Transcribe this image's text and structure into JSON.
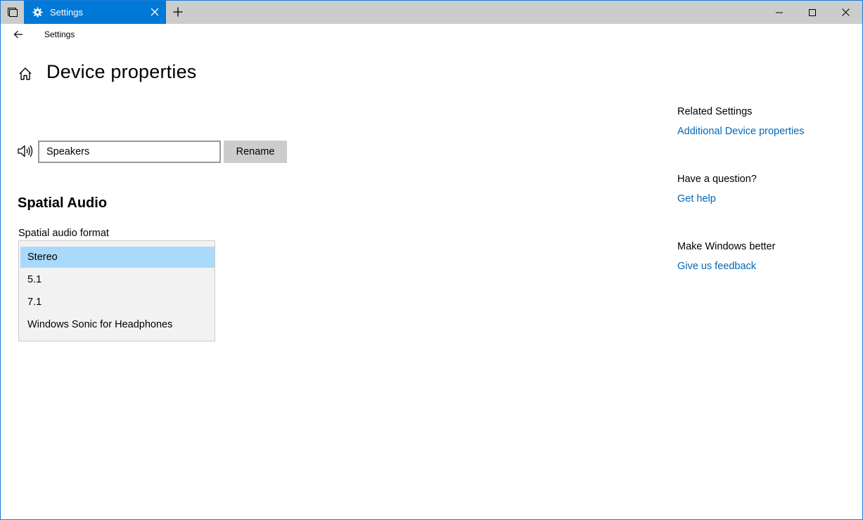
{
  "titlebar": {
    "tab_title": "Settings",
    "new_tab_icon": "plus-icon",
    "controls": [
      "minimize-icon",
      "maximize-icon",
      "close-icon"
    ]
  },
  "nav": {
    "back_icon": "back-arrow-icon",
    "title": "Settings"
  },
  "page": {
    "title": "Device properties"
  },
  "device": {
    "name_value": "Speakers",
    "rename_label": "Rename"
  },
  "spatial": {
    "section_title": "Spatial Audio",
    "format_label": "Spatial audio format",
    "options": [
      "Stereo",
      "5.1",
      "7.1",
      "Windows Sonic for Headphones"
    ],
    "selected": "Stereo"
  },
  "related": {
    "heading": "Related Settings",
    "link": "Additional Device properties"
  },
  "question": {
    "heading": "Have a question?",
    "link": "Get help"
  },
  "feedback": {
    "heading": "Make Windows better",
    "link": "Give us feedback"
  },
  "colors": {
    "accent": "#0078d7",
    "link": "#0067b8",
    "selected_bg": "#a9d9fb",
    "tabbar_bg": "#cccccc"
  }
}
